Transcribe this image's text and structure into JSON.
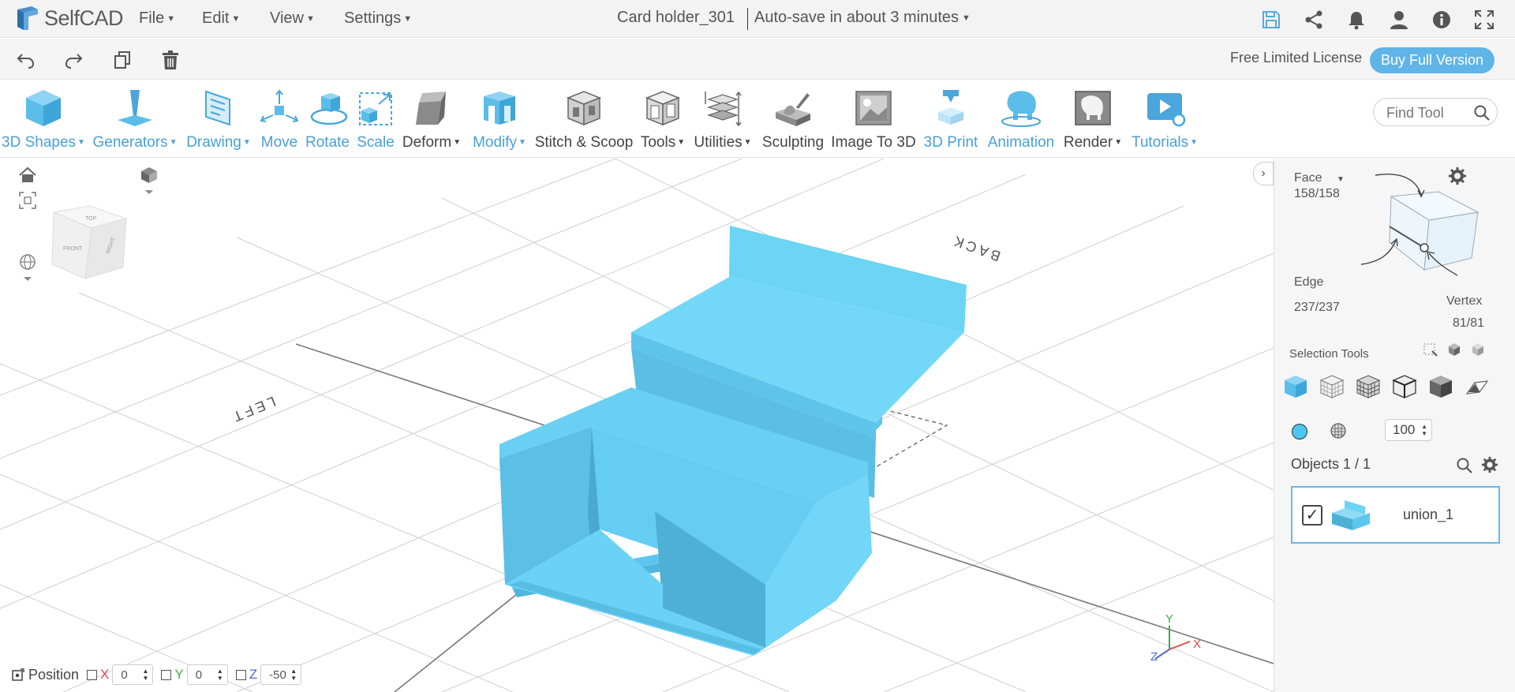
{
  "app": {
    "name": "SelfCAD"
  },
  "menu": [
    {
      "label": "File"
    },
    {
      "label": "Edit"
    },
    {
      "label": "View"
    },
    {
      "label": "Settings"
    }
  ],
  "document": {
    "title": "Card holder_301",
    "autosave": "Auto-save in about 3 minutes"
  },
  "license": {
    "text": "Free Limited License",
    "buy_label": "Buy Full Version"
  },
  "toolbar": {
    "items": [
      {
        "label": "3D Shapes"
      },
      {
        "label": "Generators"
      },
      {
        "label": "Drawing"
      },
      {
        "label": "Move"
      },
      {
        "label": "Rotate"
      },
      {
        "label": "Scale"
      },
      {
        "label": "Deform"
      },
      {
        "label": "Modify"
      },
      {
        "label": "Stitch & Scoop"
      },
      {
        "label": "Tools"
      },
      {
        "label": "Utilities"
      },
      {
        "label": "Sculpting"
      },
      {
        "label": "Image To 3D"
      },
      {
        "label": "3D Print"
      },
      {
        "label": "Animation"
      },
      {
        "label": "Render"
      },
      {
        "label": "Tutorials"
      }
    ],
    "find_placeholder": "Find Tool"
  },
  "viewport": {
    "cube_faces": {
      "top": "TOP",
      "front": "FRONT",
      "right": "RIGHT"
    },
    "grid_labels": {
      "left": "LEFT",
      "back": "BACK"
    },
    "axes": {
      "x": "X",
      "y": "Y",
      "z": "Z"
    }
  },
  "position": {
    "label": "Position",
    "x_label": "X",
    "x_value": "0",
    "y_label": "Y",
    "y_value": "0",
    "z_label": "Z",
    "z_value": "-50"
  },
  "selection": {
    "face_label": "Face",
    "face_count": "158/158",
    "edge_label": "Edge",
    "edge_count": "237/237",
    "vertex_label": "Vertex",
    "vertex_count": "81/81",
    "tools_label": "Selection Tools",
    "opacity": "100"
  },
  "objects": {
    "title": "Objects 1 / 1",
    "items": [
      {
        "name": "union_1",
        "checked": "✓"
      }
    ]
  },
  "colors": {
    "accent": "#5fb4e8",
    "model": "#6cd4f5",
    "model_shadow": "#4fb0d6"
  }
}
